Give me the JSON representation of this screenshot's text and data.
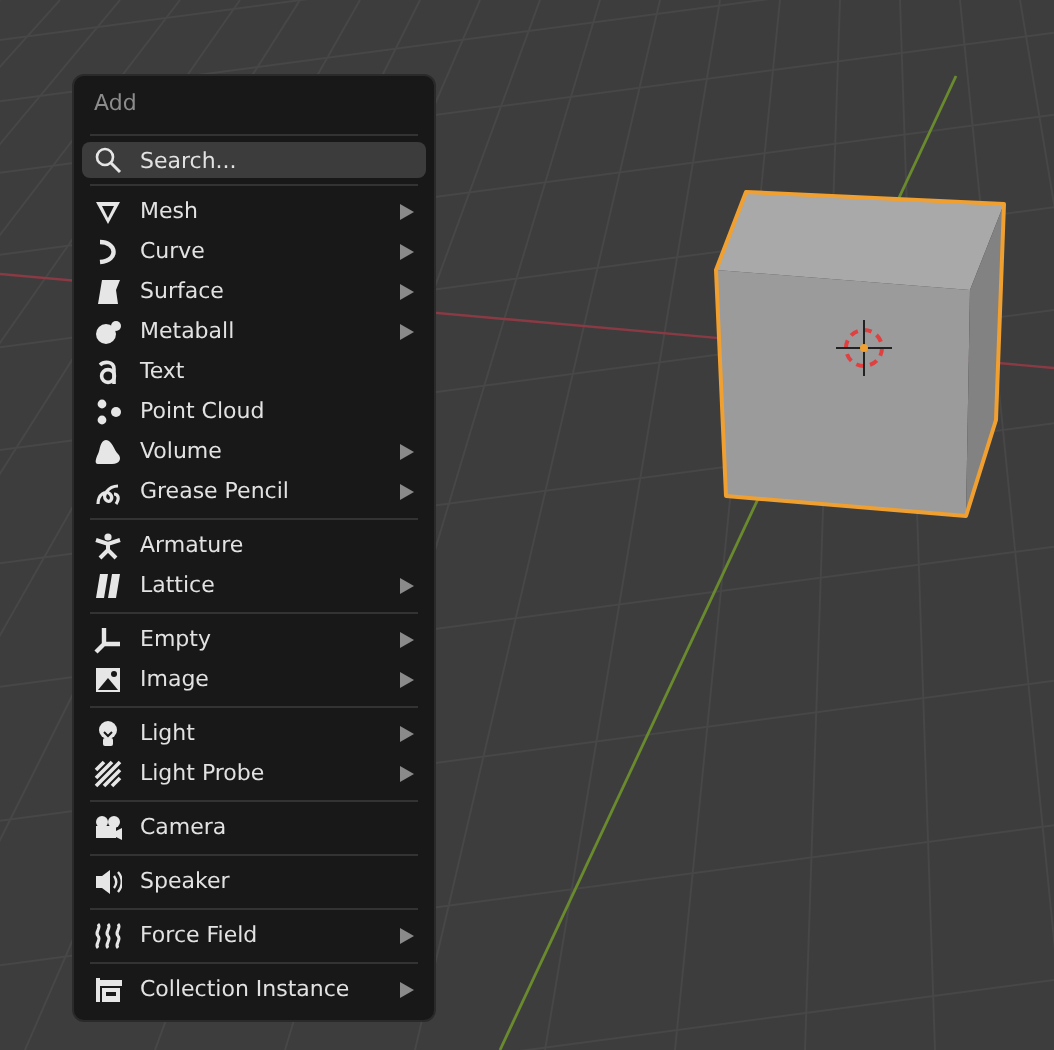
{
  "menu": {
    "title": "Add",
    "search": {
      "placeholder": "Search..."
    },
    "groups": [
      {
        "items": [
          {
            "label": "Mesh",
            "submenu": true
          },
          {
            "label": "Curve",
            "submenu": true
          },
          {
            "label": "Surface",
            "submenu": true
          },
          {
            "label": "Metaball",
            "submenu": true
          },
          {
            "label": "Text",
            "submenu": false
          },
          {
            "label": "Point Cloud",
            "submenu": false
          },
          {
            "label": "Volume",
            "submenu": true
          },
          {
            "label": "Grease Pencil",
            "submenu": true
          }
        ]
      },
      {
        "items": [
          {
            "label": "Armature",
            "submenu": false
          },
          {
            "label": "Lattice",
            "submenu": true
          }
        ]
      },
      {
        "items": [
          {
            "label": "Empty",
            "submenu": true
          },
          {
            "label": "Image",
            "submenu": true
          }
        ]
      },
      {
        "items": [
          {
            "label": "Light",
            "submenu": true
          },
          {
            "label": "Light Probe",
            "submenu": true
          }
        ]
      },
      {
        "items": [
          {
            "label": "Camera",
            "submenu": false
          }
        ]
      },
      {
        "items": [
          {
            "label": "Speaker",
            "submenu": false
          }
        ]
      },
      {
        "items": [
          {
            "label": "Force Field",
            "submenu": true
          }
        ]
      },
      {
        "items": [
          {
            "label": "Collection Instance",
            "submenu": true
          }
        ]
      }
    ]
  }
}
